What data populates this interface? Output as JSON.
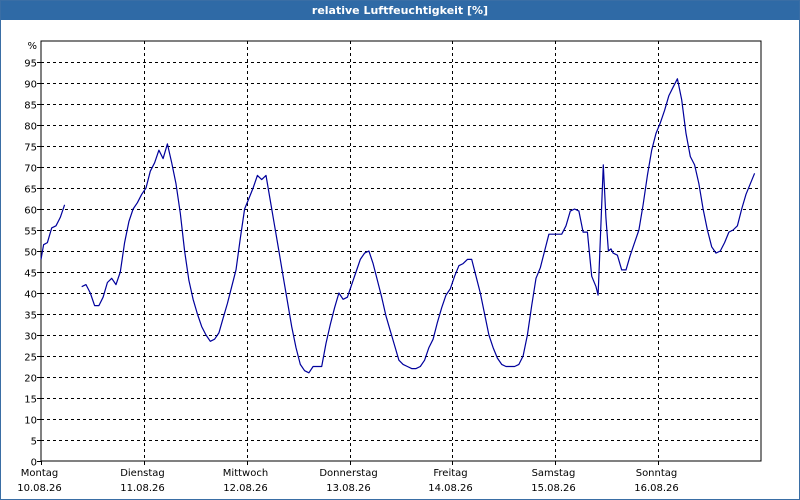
{
  "window": {
    "title": "relative Luftfeuchtigkeit [%]"
  },
  "colors": {
    "title_bar": "#2f6aa6",
    "line": "#00009c",
    "grid": "#000000"
  },
  "chart_data": {
    "type": "line",
    "title": "relative Luftfeuchtigkeit [%]",
    "ylabel": "%",
    "ylim": [
      0,
      100
    ],
    "yticks": [
      0,
      5,
      10,
      15,
      20,
      25,
      30,
      35,
      40,
      45,
      50,
      55,
      60,
      65,
      70,
      75,
      80,
      85,
      90,
      95
    ],
    "xlim": [
      0,
      168
    ],
    "x_unit": "hours",
    "grid": true,
    "x_ticks": [
      {
        "x": 0,
        "day": "Montag",
        "date": "10.08.26"
      },
      {
        "x": 24,
        "day": "Dienstag",
        "date": "11.08.26"
      },
      {
        "x": 48,
        "day": "Mittwoch",
        "date": "12.08.26"
      },
      {
        "x": 72,
        "day": "Donnerstag",
        "date": "13.08.26"
      },
      {
        "x": 96,
        "day": "Freitag",
        "date": "14.08.26"
      },
      {
        "x": 120,
        "day": "Samstag",
        "date": "15.08.26"
      },
      {
        "x": 144,
        "day": "Sonntag",
        "date": "16.08.26"
      }
    ],
    "series": [
      {
        "segments": [
          [
            [
              0,
              48
            ],
            [
              0.6,
              51.5
            ],
            [
              1.5,
              52
            ],
            [
              2.5,
              55.5
            ],
            [
              3.5,
              56
            ],
            [
              4.5,
              58
            ],
            [
              5.5,
              61
            ]
          ],
          [
            [
              9.5,
              41.5
            ],
            [
              10.5,
              42
            ],
            [
              11.5,
              40
            ],
            [
              12.5,
              37
            ],
            [
              13.5,
              37
            ],
            [
              14.5,
              39
            ],
            [
              15.5,
              42.5
            ],
            [
              16.5,
              43.5
            ],
            [
              17.5,
              42
            ],
            [
              18.5,
              45
            ],
            [
              19.5,
              52
            ],
            [
              20.5,
              57
            ],
            [
              21.5,
              60
            ],
            [
              22.5,
              61.5
            ],
            [
              23.5,
              63.5
            ],
            [
              24.5,
              65
            ],
            [
              25.5,
              69
            ],
            [
              26.5,
              71
            ],
            [
              27.5,
              74
            ],
            [
              28.5,
              72
            ],
            [
              29.5,
              75.5
            ],
            [
              30.5,
              71
            ],
            [
              31.5,
              66
            ],
            [
              32.5,
              59
            ],
            [
              33.5,
              50
            ],
            [
              34.5,
              43
            ],
            [
              35.5,
              38.5
            ],
            [
              36.5,
              35
            ],
            [
              37.5,
              32
            ],
            [
              38.5,
              30
            ],
            [
              39.5,
              28.5
            ],
            [
              40.5,
              29
            ],
            [
              41.5,
              30.5
            ],
            [
              42.5,
              34
            ],
            [
              43.5,
              37.5
            ],
            [
              44.5,
              41.5
            ],
            [
              45.5,
              45.5
            ],
            [
              46.5,
              53
            ],
            [
              47.5,
              60
            ],
            [
              48.5,
              62.5
            ],
            [
              49.5,
              65
            ],
            [
              50.5,
              68
            ],
            [
              51.5,
              67
            ],
            [
              52.5,
              68
            ],
            [
              53.5,
              62
            ],
            [
              54.5,
              56
            ],
            [
              55.5,
              50
            ],
            [
              56.5,
              44
            ],
            [
              57.5,
              38
            ],
            [
              58.5,
              32
            ],
            [
              59.5,
              27
            ],
            [
              60.5,
              23
            ],
            [
              61.5,
              21.5
            ],
            [
              62.5,
              21
            ],
            [
              63.5,
              22.5
            ],
            [
              64.5,
              22.5
            ],
            [
              65.5,
              22.5
            ],
            [
              66.5,
              28
            ],
            [
              67.5,
              32.5
            ],
            [
              68.5,
              36.5
            ],
            [
              69.5,
              40
            ],
            [
              70.5,
              38.5
            ],
            [
              71.5,
              39
            ],
            [
              72.5,
              42
            ],
            [
              73.5,
              45
            ],
            [
              74.5,
              48
            ],
            [
              75.5,
              49.5
            ],
            [
              76.5,
              50
            ],
            [
              77.5,
              47
            ],
            [
              78.5,
              43
            ],
            [
              79.5,
              39
            ],
            [
              80.5,
              34.5
            ],
            [
              81.5,
              31
            ],
            [
              82.5,
              27.5
            ],
            [
              83.5,
              24
            ],
            [
              84.5,
              23
            ],
            [
              85.5,
              22.5
            ],
            [
              86.5,
              22
            ],
            [
              87.5,
              22
            ],
            [
              88.5,
              22.5
            ],
            [
              89.5,
              24
            ],
            [
              90.5,
              27
            ],
            [
              91.5,
              29
            ],
            [
              92.5,
              33
            ],
            [
              93.5,
              36.5
            ],
            [
              94.5,
              39.5
            ],
            [
              95.5,
              41
            ],
            [
              96.5,
              44
            ],
            [
              97.5,
              46.5
            ],
            [
              98.5,
              47
            ],
            [
              99.5,
              48
            ],
            [
              100.5,
              48
            ],
            [
              101.5,
              44
            ],
            [
              102.5,
              40
            ],
            [
              103.5,
              35
            ],
            [
              104.5,
              30
            ],
            [
              105.5,
              27
            ],
            [
              106.5,
              24.5
            ],
            [
              107.5,
              23
            ],
            [
              108.5,
              22.5
            ],
            [
              109.5,
              22.5
            ],
            [
              110.5,
              22.5
            ],
            [
              111.5,
              23
            ],
            [
              112.5,
              25
            ],
            [
              113.5,
              30
            ],
            [
              114.5,
              37
            ],
            [
              115.5,
              43.5
            ],
            [
              116.5,
              46
            ],
            [
              117.5,
              50
            ],
            [
              118.5,
              54
            ],
            [
              119.5,
              54
            ],
            [
              120.5,
              54
            ],
            [
              121.5,
              54
            ],
            [
              122.5,
              56
            ],
            [
              123.5,
              59.5
            ],
            [
              124.5,
              60
            ],
            [
              125.5,
              59.5
            ],
            [
              126.5,
              54.5
            ],
            [
              127.5,
              54.5
            ],
            [
              128.5,
              44
            ],
            [
              129.5,
              41.5
            ],
            [
              130,
              39.5
            ],
            [
              130.6,
              55
            ],
            [
              131.2,
              70.5
            ],
            [
              131.8,
              58
            ],
            [
              132.4,
              50
            ],
            [
              133,
              50.5
            ],
            [
              133.5,
              49.5
            ],
            [
              134.5,
              49
            ],
            [
              135.5,
              45.5
            ],
            [
              136.5,
              45.5
            ],
            [
              137.5,
              49
            ],
            [
              138.5,
              52
            ],
            [
              139.5,
              55
            ],
            [
              140.5,
              61
            ],
            [
              141.5,
              68
            ],
            [
              142.5,
              74
            ],
            [
              143.5,
              78
            ],
            [
              144.5,
              80.5
            ],
            [
              145.5,
              83.5
            ],
            [
              146.5,
              87
            ],
            [
              147.5,
              89
            ],
            [
              148.5,
              91
            ],
            [
              149.5,
              86
            ],
            [
              150.5,
              78
            ],
            [
              151.5,
              72.5
            ],
            [
              152.5,
              70.5
            ],
            [
              153.5,
              66
            ],
            [
              154.5,
              60
            ],
            [
              155.5,
              55
            ],
            [
              156.5,
              51
            ],
            [
              157.5,
              49.5
            ],
            [
              158.5,
              50
            ],
            [
              159.5,
              52
            ],
            [
              160.5,
              54.5
            ],
            [
              161.5,
              55
            ],
            [
              162.5,
              56
            ],
            [
              163.5,
              60
            ],
            [
              164.5,
              63.5
            ],
            [
              165.5,
              66
            ],
            [
              166.5,
              68.5
            ]
          ]
        ]
      }
    ]
  }
}
